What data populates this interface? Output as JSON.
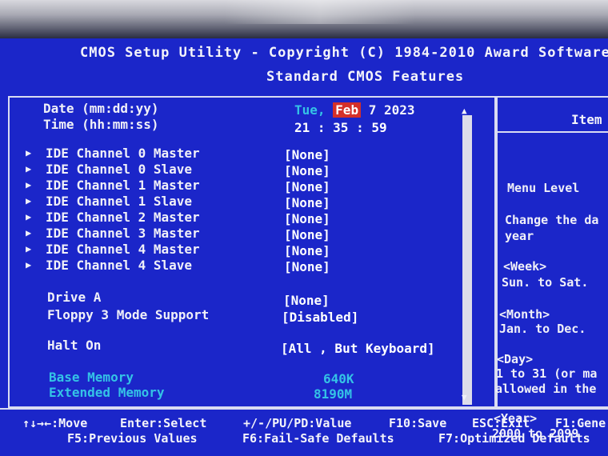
{
  "header": {
    "line1": "CMOS Setup Utility - Copyright (C) 1984-2010 Award Software",
    "line2": "Standard CMOS Features"
  },
  "date": {
    "label": "Date (mm:dd:yy)",
    "weekday": "Tue,",
    "month": "Feb",
    "rest": "7 2023"
  },
  "time": {
    "label": "Time (hh:mm:ss)",
    "value": "21 : 35 : 59"
  },
  "ide_channels": [
    {
      "label": "IDE Channel 0 Master",
      "value": "[None]"
    },
    {
      "label": "IDE Channel 0 Slave",
      "value": "[None]"
    },
    {
      "label": "IDE Channel 1 Master",
      "value": "[None]"
    },
    {
      "label": "IDE Channel 1 Slave",
      "value": "[None]"
    },
    {
      "label": "IDE Channel 2 Master",
      "value": "[None]"
    },
    {
      "label": "IDE Channel 3 Master",
      "value": "[None]"
    },
    {
      "label": "IDE Channel 4 Master",
      "value": "[None]"
    },
    {
      "label": "IDE Channel 4 Slave",
      "value": "[None]"
    }
  ],
  "drive_a": {
    "label": "Drive A",
    "value": "[None]"
  },
  "floppy": {
    "label": "Floppy 3 Mode Support",
    "value": "[Disabled]"
  },
  "halt_on": {
    "label": "Halt On",
    "value": "[All , But Keyboard]"
  },
  "base_memory": {
    "label": "Base Memory",
    "value": "640K"
  },
  "extended_memory": {
    "label": "Extended Memory",
    "value": "8190M"
  },
  "help": {
    "title": "Item",
    "menu_level": "Menu Level",
    "desc1": "Change the da",
    "desc2": "year",
    "week_title": "<Week>",
    "week_range": "Sun. to Sat.",
    "month_title": "<Month>",
    "month_range": "Jan. to Dec.",
    "day_title": "<Day>",
    "day_range1": "1 to 31 (or ma",
    "day_range2": "allowed in the",
    "year_title": "<Year>",
    "year_range": "2000 to 2099"
  },
  "footer": {
    "move": "↑↓→←:Move",
    "enter": "Enter:Select",
    "value": "+/-/PU/PD:Value",
    "save": "F10:Save",
    "exit": "ESC:Exit",
    "general": "F1:Gene",
    "prev": "F5:Previous Values",
    "failsafe": "F6:Fail-Safe Defaults",
    "optimized": "F7:Optimized Defaults"
  },
  "colors": {
    "bios_blue": "#1b26c9",
    "highlight_red": "#d4302a",
    "cyan_text": "#34c3e6"
  }
}
